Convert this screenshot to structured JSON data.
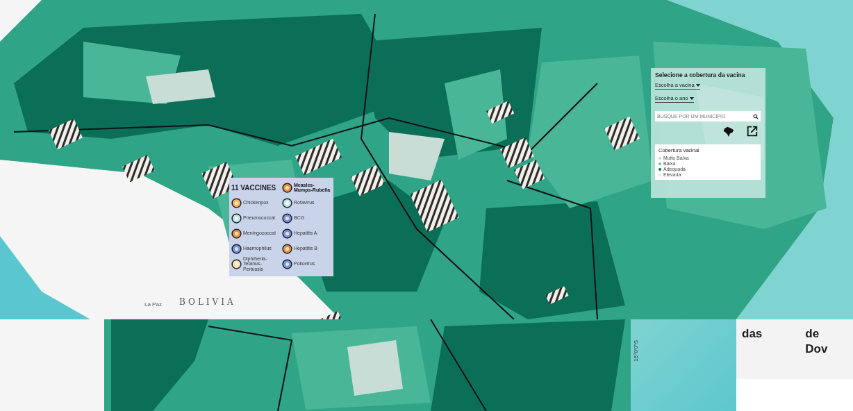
{
  "map": {
    "labels": [
      {
        "text": "BOLIVIA",
        "kind": "country"
      },
      {
        "text": "La Paz",
        "kind": "city"
      }
    ]
  },
  "coverage_panel": {
    "title": "Selecione a cobertura da vacina",
    "vaccine_select": {
      "label": "Escolha a vacina"
    },
    "year_select": {
      "label": "Escolha o ano"
    },
    "search": {
      "placeholder": "BUSQUE POR UM MUNICÍPIO"
    },
    "legend": {
      "title": "Cobertura vacinal",
      "items": [
        {
          "label": "Muito Baixa",
          "color": "#c6d9d2"
        },
        {
          "label": "Baixa",
          "color": "#6cc5a4"
        },
        {
          "label": "Adequada",
          "color": "#0a6e55"
        },
        {
          "label": "Elevada",
          "color": "#dde7e3"
        }
      ]
    }
  },
  "vaccines_card": {
    "title": "11 VACCINES",
    "items": [
      {
        "label": "Measles-Mumps-Rubella",
        "color": "#f0923a"
      },
      {
        "label": "Chickenpox",
        "color": "#f7b25c"
      },
      {
        "label": "Rotavirus",
        "color": "#bfe9e2"
      },
      {
        "label": "Pneumococcal",
        "color": "#bfe9e2"
      },
      {
        "label": "BCG",
        "color": "#7b95d6"
      },
      {
        "label": "Meningococcal",
        "color": "#f0923a"
      },
      {
        "label": "Hepatitis A",
        "color": "#7b95d6"
      },
      {
        "label": "Haemophilus",
        "color": "#7b95d6"
      },
      {
        "label": "Hepatitis B",
        "color": "#f0923a"
      },
      {
        "label": "Diphtheria-Tetanus-Pertussis",
        "color": "#fbe3a8"
      },
      {
        "label": "Poliovirus",
        "color": "#7b95d6"
      }
    ]
  },
  "bottom_map": {
    "coordinate_label": "15°0'0\"S"
  },
  "article_fragment": {
    "column_1": [
      "das"
    ],
    "column_2": [
      "de",
      "Dov"
    ]
  }
}
